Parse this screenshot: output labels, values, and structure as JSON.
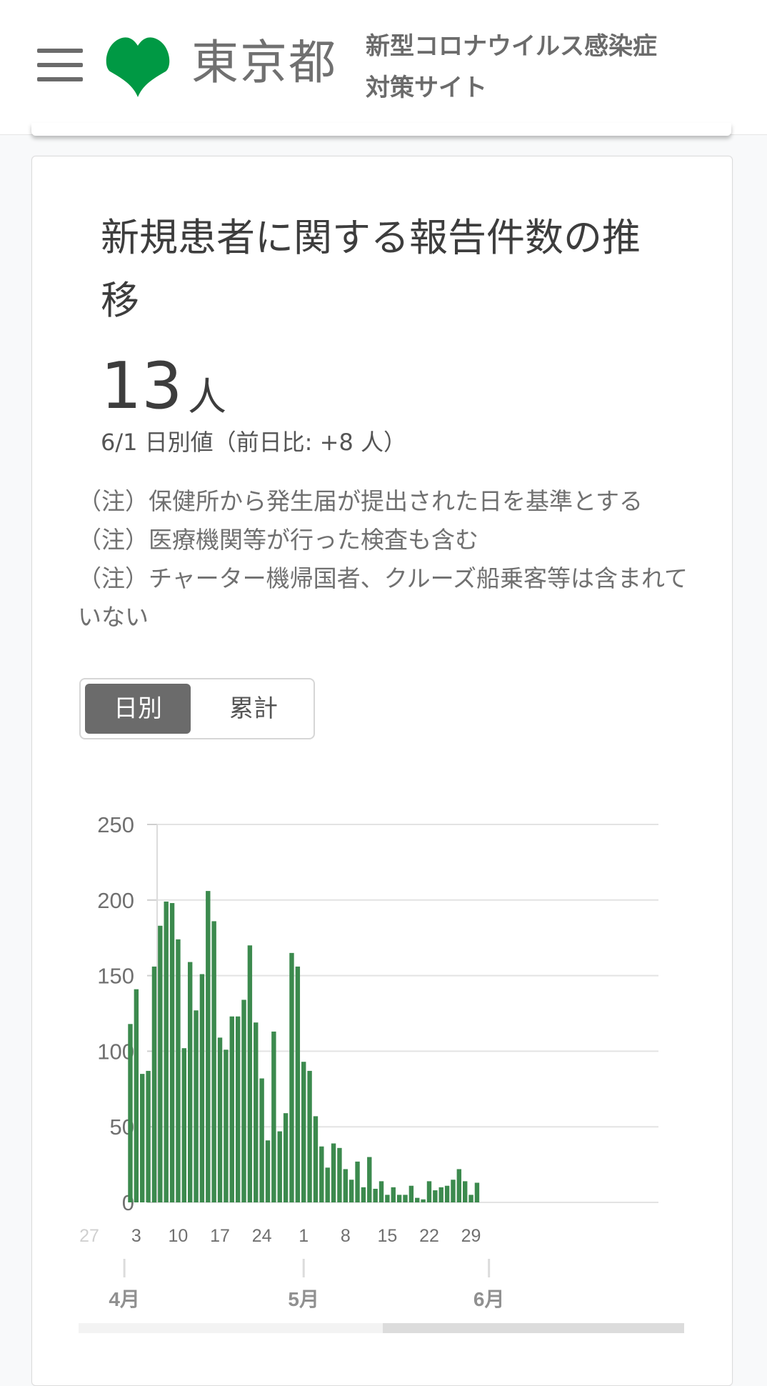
{
  "header": {
    "logo_text": "東京都",
    "site_title_line1": "新型コロナウイルス感染症",
    "site_title_line2": "対策サイト",
    "logo_color": "#009944"
  },
  "card": {
    "title": "新規患者に関する報告件数の推移",
    "value": "13",
    "unit": "人",
    "sub_value": "6/1 日別値（前日比: +8 人）",
    "notes": [
      "（注）保健所から発生届が提出された日を基準とする",
      "（注）医療機関等が行った検査も含む",
      "（注）チャーター機帰国者、クルーズ船乗客等は含まれていない"
    ],
    "toggle": {
      "active_label": "日別",
      "inactive_label": "累計"
    }
  },
  "chart_data": {
    "type": "bar",
    "bar_color": "#3c8a4e",
    "ylim": [
      0,
      250
    ],
    "yticks": [
      "0",
      "50",
      "100",
      "150",
      "200",
      "250"
    ],
    "x_tick_labels": [
      {
        "day_index": 5,
        "label": "3"
      },
      {
        "day_index": 12,
        "label": "10"
      },
      {
        "day_index": 19,
        "label": "17"
      },
      {
        "day_index": 26,
        "label": "24"
      },
      {
        "day_index": 33,
        "label": "1"
      },
      {
        "day_index": 40,
        "label": "8"
      },
      {
        "day_index": 47,
        "label": "15"
      },
      {
        "day_index": 54,
        "label": "22"
      },
      {
        "day_index": 61,
        "label": "29"
      }
    ],
    "partial_left_label": "27",
    "month_labels": [
      {
        "day_index": 3,
        "label": "4月"
      },
      {
        "day_index": 33,
        "label": "5月"
      },
      {
        "day_index": 64,
        "label": "6月"
      }
    ],
    "start_day_index": 4,
    "values": [
      118,
      141,
      85,
      87,
      156,
      183,
      199,
      198,
      174,
      102,
      159,
      127,
      151,
      206,
      186,
      109,
      101,
      123,
      123,
      134,
      170,
      119,
      82,
      41,
      113,
      47,
      59,
      165,
      156,
      93,
      87,
      57,
      37,
      23,
      39,
      36,
      22,
      15,
      27,
      10,
      30,
      9,
      14,
      5,
      10,
      5,
      5,
      11,
      3,
      2,
      14,
      8,
      10,
      11,
      15,
      22,
      14,
      5,
      13
    ]
  }
}
